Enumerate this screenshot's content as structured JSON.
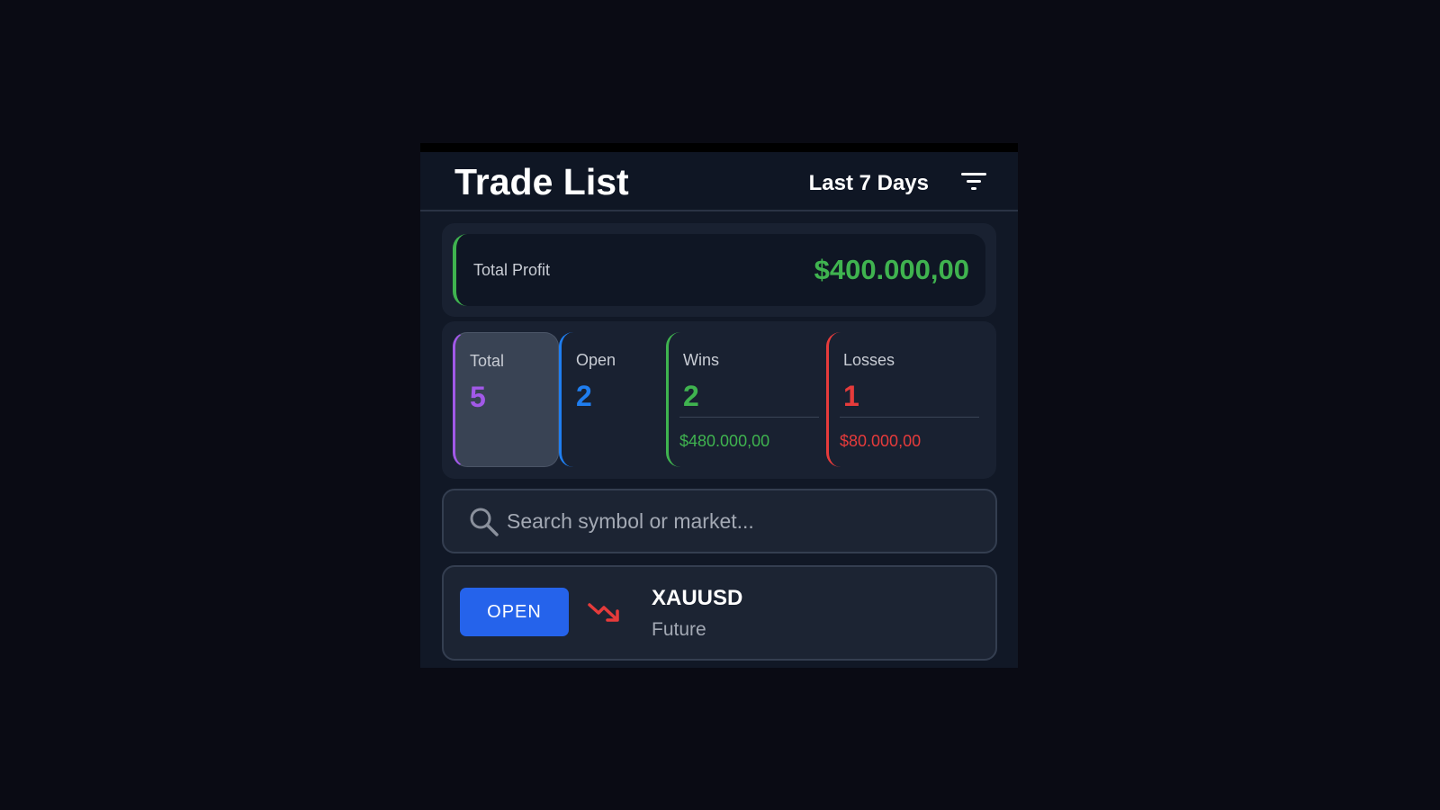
{
  "header": {
    "title": "Trade List",
    "range_label": "Last 7 Days",
    "filter_icon": "filter-icon"
  },
  "profit": {
    "label": "Total Profit",
    "value": "$400.000,00",
    "accent": "#3fb34f"
  },
  "stats": {
    "total": {
      "label": "Total",
      "count": "5",
      "color": "#a259e8"
    },
    "open": {
      "label": "Open",
      "count": "2",
      "color": "#1f7ef0"
    },
    "wins": {
      "label": "Wins",
      "count": "2",
      "amount": "$480.000,00",
      "color": "#3fb34f"
    },
    "losses": {
      "label": "Losses",
      "count": "1",
      "amount": "$80.000,00",
      "color": "#e63b3b"
    }
  },
  "search": {
    "placeholder": "Search symbol or market...",
    "value": "",
    "icon": "search-icon"
  },
  "trades": [
    {
      "status": "OPEN",
      "status_color": "#2563eb",
      "trend_icon": "trend-down-icon",
      "trend_color": "#e63b3b",
      "symbol": "XAUUSD",
      "market": "Future"
    }
  ]
}
